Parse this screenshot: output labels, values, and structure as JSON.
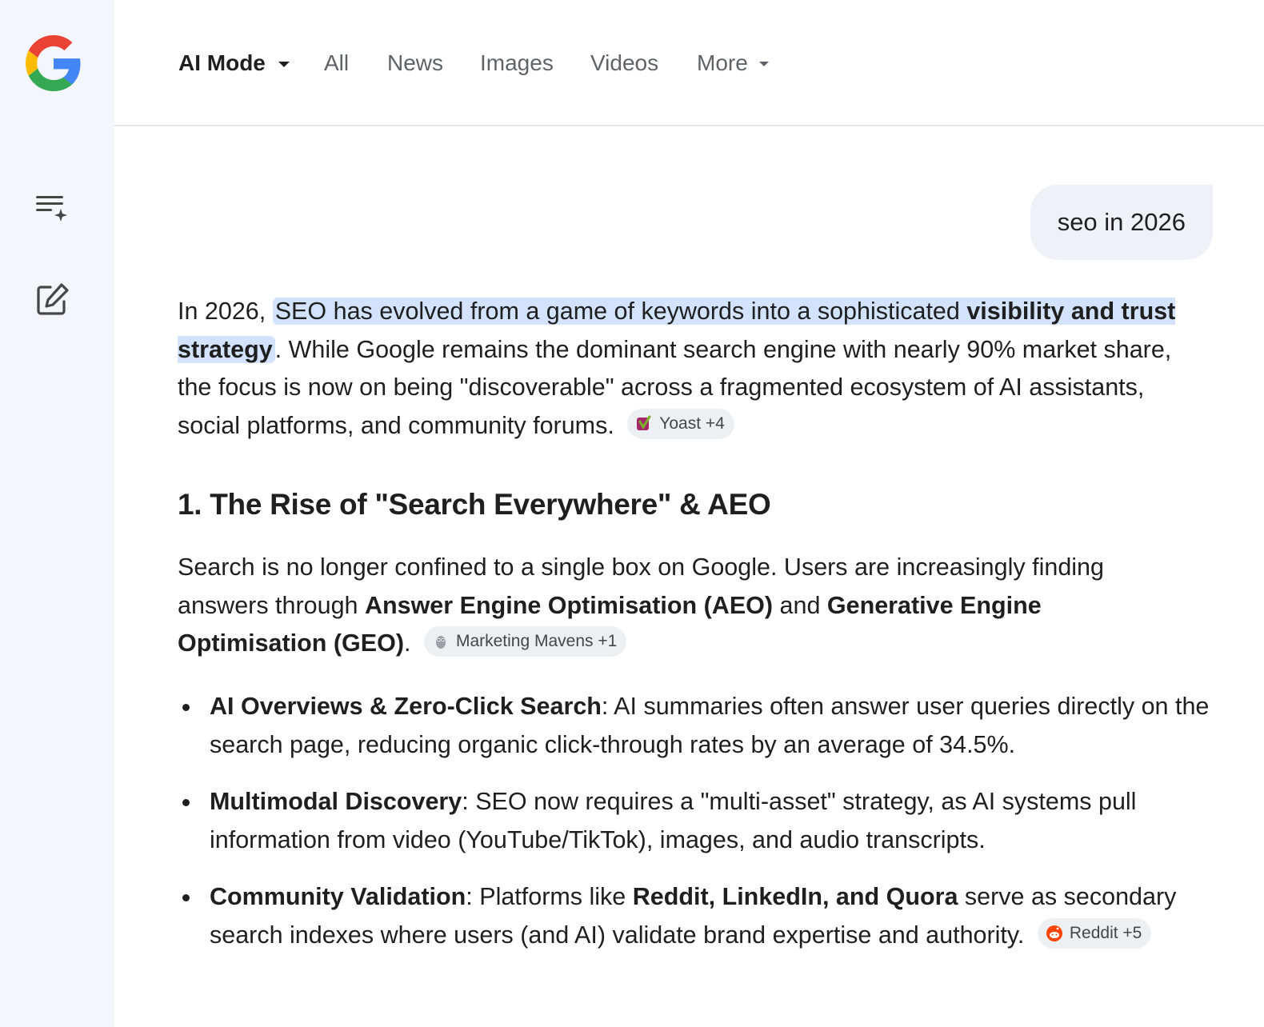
{
  "sidebar": {
    "logo": "google-g-logo",
    "history_icon": "search-history-icon",
    "new_chat_icon": "edit-icon"
  },
  "tabs": [
    {
      "label": "AI Mode",
      "active": true
    },
    {
      "label": "All"
    },
    {
      "label": "News"
    },
    {
      "label": "Images"
    },
    {
      "label": "Videos"
    },
    {
      "label": "More"
    }
  ],
  "query": "seo in 2026",
  "answer": {
    "intro_prefix": "In 2026, ",
    "intro_highlight_normal": "SEO has evolved from a game of keywords into a sophisticated ",
    "intro_highlight_bold": "visibility and trust strategy",
    "intro_rest": ". While Google remains the dominant search engine with nearly 90% market share, the focus is now on being \"discoverable\" across a fragmented ecosystem of AI assistants, social platforms, and community forums.",
    "intro_chip": "Yoast +4",
    "section_heading": "1. The Rise of \"Search Everywhere\" & AEO",
    "section_p1": "Search is no longer confined to a single box on Google. Users are increasingly finding answers through ",
    "section_b1": "Answer Engine Optimisation (AEO)",
    "section_p2": " and ",
    "section_b2": "Generative Engine Optimisation (GEO)",
    "section_p3": ".",
    "section_chip": "Marketing Mavens +1",
    "bullets": [
      {
        "title": "AI Overviews & Zero-Click Search",
        "text": ": AI summaries often answer user queries directly on the search page, reducing organic click-through rates by an average of 34.5%."
      },
      {
        "title": "Multimodal Discovery",
        "text": ": SEO now requires a \"multi-asset\" strategy, as AI systems pull information from video (YouTube/TikTok), images, and audio transcripts."
      },
      {
        "title": "Community Validation",
        "text_a": ": Platforms like ",
        "bold_b": "Reddit, LinkedIn, and Quora",
        "text_c": " serve as secondary search indexes where users (and AI) validate brand expertise and authority.",
        "chip": "Reddit +5"
      }
    ]
  },
  "colors": {
    "highlight": "#d3e3fd",
    "chip_bg": "#edf0f3",
    "sidebar_bg": "#f3f6fb",
    "query_bg": "#eef1f6"
  }
}
